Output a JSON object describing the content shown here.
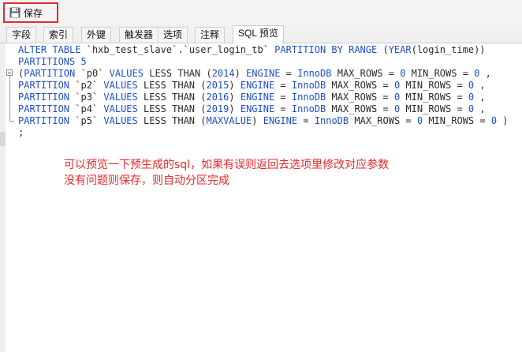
{
  "toolbar": {
    "save_label": "保存",
    "save_icon": "floppy-disk-icon"
  },
  "tabs": [
    {
      "label": "字段"
    },
    {
      "label": "索引"
    },
    {
      "label": "外键"
    },
    {
      "label": "触发器"
    },
    {
      "label": "选项"
    },
    {
      "label": "注释"
    },
    {
      "label": "SQL 预览",
      "active": true
    }
  ],
  "sql_lines": [
    [
      "ALTER TABLE `hxb_test_slave`.`user_login_tb` PARTITION BY RANGE (YEAR(login_time))"
    ],
    [
      "PARTITIONS 5"
    ],
    [
      "(PARTITION `p0` VALUES LESS THAN (2014) ENGINE = InnoDB MAX_ROWS = 0 MIN_ROWS = 0 ,"
    ],
    [
      "PARTITION `p2` VALUES LESS THAN (2015) ENGINE = InnoDB MAX_ROWS = 0 MIN_ROWS = 0 ,"
    ],
    [
      "PARTITION `p3` VALUES LESS THAN (2016) ENGINE = InnoDB MAX_ROWS = 0 MIN_ROWS = 0 ,"
    ],
    [
      "PARTITION `p4` VALUES LESS THAN (2019) ENGINE = InnoDB MAX_ROWS = 0 MIN_ROWS = 0 ,"
    ],
    [
      "PARTITION `p5` VALUES LESS THAN (MAXVALUE) ENGINE = InnoDB MAX_ROWS = 0 MIN_ROWS = 0 )"
    ],
    [
      ";"
    ]
  ],
  "annotation": {
    "line1": "可以预览一下预生成的sql，如果有误则返回去选项里修改对应参数",
    "line2": "没有问题则保存，则自动分区完成"
  },
  "colors": {
    "keyword": "#1e4fd1",
    "annotation": "#e82a2a",
    "highlight_border": "#e02b2b"
  }
}
